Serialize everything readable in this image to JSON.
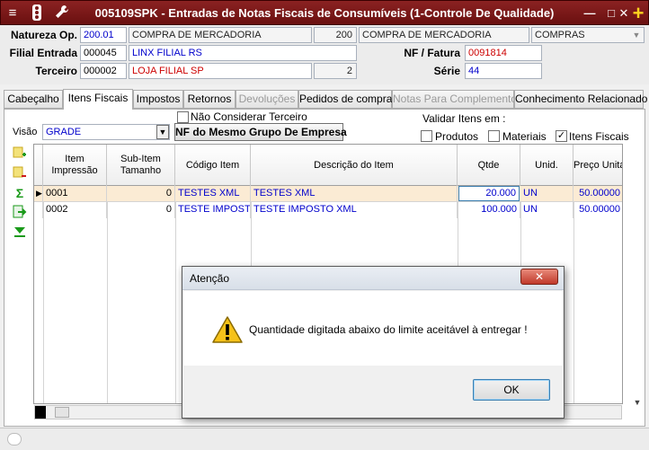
{
  "window": {
    "title": "005109SPK - Entradas de Notas Fiscais de Consumíveis (1-Controle De Qualidade)",
    "title_bg": "#7a1818"
  },
  "header": {
    "natureza_label": "Natureza Op.",
    "natureza_code": "200.01",
    "natureza_desc": "COMPRA DE MERCADORIA",
    "natureza_num": "200",
    "natureza_desc2": "COMPRA DE MERCADORIA",
    "tipo_select": "COMPRAS",
    "filial_label": "Filial Entrada",
    "filial_code": "000045",
    "filial_name": "LINX FILIAL RS",
    "terceiro_label": "Terceiro",
    "terceiro_code": "000002",
    "terceiro_name": "LOJA FILIAL SP",
    "terceiro_num": "2",
    "nf_label": "NF / Fatura",
    "nf_value": "0091814",
    "serie_label": "Série",
    "serie_value": "44"
  },
  "tabs": [
    {
      "label": "Cabeçalho",
      "state": "normal"
    },
    {
      "label": "Itens Fiscais",
      "state": "active"
    },
    {
      "label": "Impostos",
      "state": "normal"
    },
    {
      "label": "Retornos",
      "state": "normal"
    },
    {
      "label": "Devoluções",
      "state": "disabled"
    },
    {
      "label": "Pedidos de compra",
      "state": "normal"
    },
    {
      "label": "Notas Para Complemento",
      "state": "disabled"
    },
    {
      "label": "Conhecimento Relacionado",
      "state": "normal"
    }
  ],
  "panel": {
    "visao_label": "Visão",
    "visao_value": "GRADE",
    "nao_considerar_label": "Não Considerar Terceiro",
    "nf_grupo_button": "NF do Mesmo Grupo De Empresa",
    "validar_label": "Validar Itens em :",
    "chk_produtos": "Produtos",
    "chk_materiais": "Materiais",
    "chk_itens_fiscais": "Itens Fiscais",
    "chk_itens_fiscais_checked": true
  },
  "grid": {
    "columns": [
      "Item Impressão",
      "Sub-Item Tamanho",
      "Código Item",
      "Descrição do Item",
      "Qtde",
      "Unid.",
      "Preço Unitá"
    ],
    "rows": [
      {
        "item": "0001",
        "sub": "0",
        "codigo": "TESTES XML",
        "descricao": "TESTES XML",
        "qtde": "20.000",
        "unid": "UN",
        "preco": "50.00000"
      },
      {
        "item": "0002",
        "sub": "0",
        "codigo": "TESTE IMPOSTO",
        "descricao": "TESTE IMPOSTO XML",
        "qtde": "100.000",
        "unid": "UN",
        "preco": "50.00000"
      }
    ],
    "selected_row_color": "#fbebd4"
  },
  "dialog": {
    "title": "Atenção",
    "message": "Quantidade digitada abaixo do limite aceitável à entregar !",
    "ok_label": "OK",
    "close_label": "✕"
  },
  "icons": [
    "traffic-light-icon",
    "wrench-icon",
    "minimize-icon",
    "maximize-icon",
    "close-icon",
    "add-icon",
    "warning-icon"
  ]
}
